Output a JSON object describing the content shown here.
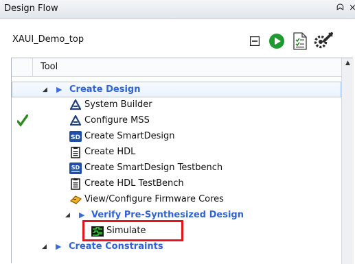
{
  "window": {
    "title": "Design Flow",
    "pin_glyph": "ᗣ",
    "close_glyph": "×"
  },
  "project": {
    "name": "XAUI_Demo_top"
  },
  "toolbar": {
    "icons": [
      "collapse-icon",
      "run-icon",
      "report-icon",
      "options-icon"
    ]
  },
  "tree": {
    "column_header": "Tool",
    "rows": [
      {
        "label": "Create Design",
        "kind": "group",
        "level": 0,
        "expanded": true,
        "selected": true,
        "done": false
      },
      {
        "label": "System Builder",
        "kind": "tool",
        "icon": "system-builder-icon",
        "level": 1,
        "done": false
      },
      {
        "label": "Configure MSS",
        "kind": "tool",
        "icon": "configure-mss-icon",
        "level": 1,
        "done": true
      },
      {
        "label": "Create SmartDesign",
        "kind": "tool",
        "icon": "smartdesign-icon",
        "icon_text": "SD",
        "level": 1,
        "done": false
      },
      {
        "label": "Create HDL",
        "kind": "tool",
        "icon": "hdl-file-icon",
        "level": 1,
        "done": false
      },
      {
        "label": "Create SmartDesign Testbench",
        "kind": "tool",
        "icon": "smartdesign-testbench-icon",
        "icon_text": "SD",
        "level": 1,
        "done": false
      },
      {
        "label": "Create HDL TestBench",
        "kind": "tool",
        "icon": "hdl-testbench-icon",
        "level": 1,
        "done": false
      },
      {
        "label": "View/Configure Firmware Cores",
        "kind": "tool",
        "icon": "firmware-cores-icon",
        "level": 1,
        "done": false
      },
      {
        "label": "Verify Pre-Synthesized Design",
        "kind": "group",
        "level": 1,
        "expanded": true,
        "done": false
      },
      {
        "label": "Simulate",
        "kind": "tool",
        "icon": "simulate-icon",
        "level": 2,
        "done": false,
        "highlighted": true
      },
      {
        "label": "Create Constraints",
        "kind": "group",
        "level": 0,
        "expanded": true,
        "done": false
      }
    ]
  },
  "colors": {
    "group_text": "#2f63d6",
    "check": "#2f8a1f",
    "highlight_box": "#e8141b",
    "selection": "#9fc6ef"
  }
}
